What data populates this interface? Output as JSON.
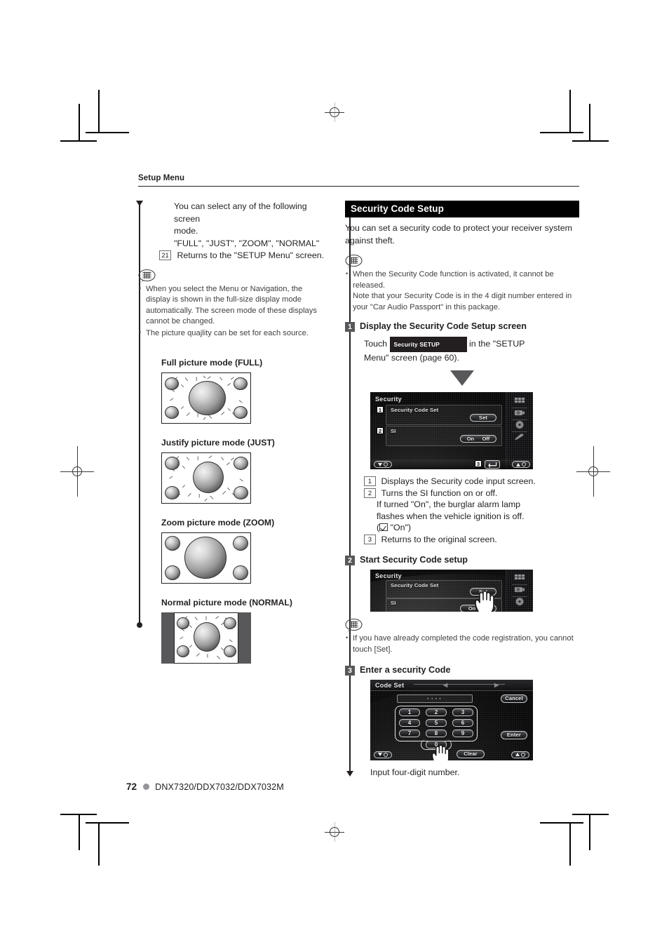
{
  "page": {
    "running_head": "Setup Menu",
    "page_number": "72",
    "models": "DNX7320/DDX7032/DDX7032M"
  },
  "left_column": {
    "intro_lines": [
      "You can select any of the following screen",
      "mode.",
      "\"FULL\", \"JUST\", \"ZOOM\", \"NORMAL\""
    ],
    "return_item": {
      "num": "21",
      "text": "Returns to the \"SETUP Menu\" screen."
    },
    "notes": [
      "When you select the Menu or Navigation, the display is shown in the full-size display mode automatically. The screen mode of these displays cannot be changed.",
      "The picture quajlity can be set for each source."
    ],
    "figures": [
      {
        "caption": "Full picture mode (FULL)",
        "mode": "full"
      },
      {
        "caption": "Justify picture mode (JUST)",
        "mode": "just"
      },
      {
        "caption": "Zoom picture mode (ZOOM)",
        "mode": "zoom"
      },
      {
        "caption": "Normal picture mode (NORMAL)",
        "mode": "normal"
      }
    ]
  },
  "right_column": {
    "section_title": "Security Code Setup",
    "intro": "You can set a security code to protect your receiver system against theft.",
    "notes": [
      "When the Security Code function is activated, it cannot be released.",
      "Note that your Security Code is in the 4 digit number entered in your \"Car Audio Passport\" in this package."
    ],
    "step1": {
      "num": "1",
      "title": "Display the Security Code Setup screen",
      "touch_prefix": "Touch",
      "keycap": "Security SETUP",
      "touch_suffix_line1": "in the \"SETUP",
      "touch_suffix_line2": "Menu\" screen (page 60)."
    },
    "security_screen": {
      "title": "Security",
      "row1_marker": "1",
      "row1_label": "Security Code Set",
      "row1_button": "Set",
      "row2_marker": "2",
      "row2_label": "SI",
      "row2_on": "On",
      "row2_off": "Off",
      "return_marker": "3"
    },
    "legend": [
      {
        "num": "1",
        "lines": [
          "Displays the Security code input screen."
        ]
      },
      {
        "num": "2",
        "lines": [
          "Turns the SI function on or off.",
          "If turned \"On\", the burglar alarm lamp",
          "flashes when the vehicle ignition is off."
        ],
        "default_prefix": "(",
        "default_value": "\"On\")"
      },
      {
        "num": "3",
        "lines": [
          "Returns to the original screen."
        ]
      }
    ],
    "step2": {
      "num": "2",
      "title": "Start Security Code setup",
      "note": "If you have already completed the code registration, you cannot touch [Set]."
    },
    "step3": {
      "num": "3",
      "title": "Enter a security Code",
      "caption": "Input four-digit number."
    },
    "code_screen": {
      "title": "Code Set",
      "code_value": "····",
      "cancel": "Cancel",
      "enter": "Enter",
      "clear": "Clear",
      "keys": [
        "1",
        "2",
        "3",
        "4",
        "5",
        "6",
        "7",
        "8",
        "9",
        "0"
      ],
      "prev_arrow": "◀",
      "next_arrow": "▶"
    }
  },
  "colors": {
    "ink": "#231f20",
    "gray_text": "#414042",
    "step_badge": "#58585b",
    "section_bar": "#000000",
    "screen_bg": "#0c0c0c"
  }
}
